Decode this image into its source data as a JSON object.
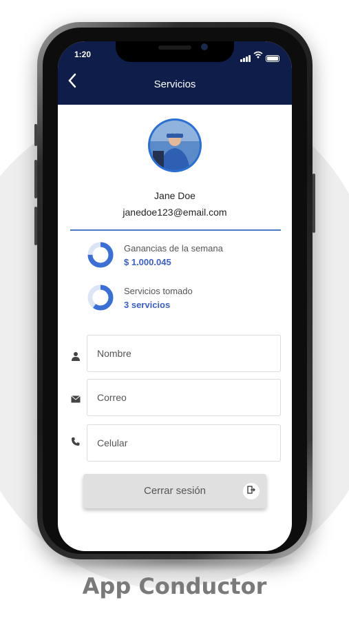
{
  "status_bar": {
    "time": "1:20"
  },
  "header": {
    "title": "Servicios",
    "back_icon": "chevron-left-icon"
  },
  "profile": {
    "name": "Jane Doe",
    "email": "janedoe123@email.com",
    "avatar_ring_color": "#2a6fd6"
  },
  "stats": [
    {
      "label": "Ganancias de la semana",
      "value": "$ 1.000.045",
      "fraction": 0.75
    },
    {
      "label": "Servicios tomado",
      "value": "3 servicios",
      "fraction": 0.6
    }
  ],
  "form": {
    "name_placeholder": "Nombre",
    "email_placeholder": "Correo",
    "phone_placeholder": "Celular"
  },
  "logout": {
    "label": "Cerrar sesión"
  },
  "caption": "App Conductor",
  "colors": {
    "header_bg": "#0f1d4a",
    "accent": "#3a5fc8",
    "divider": "#4a78c0"
  }
}
